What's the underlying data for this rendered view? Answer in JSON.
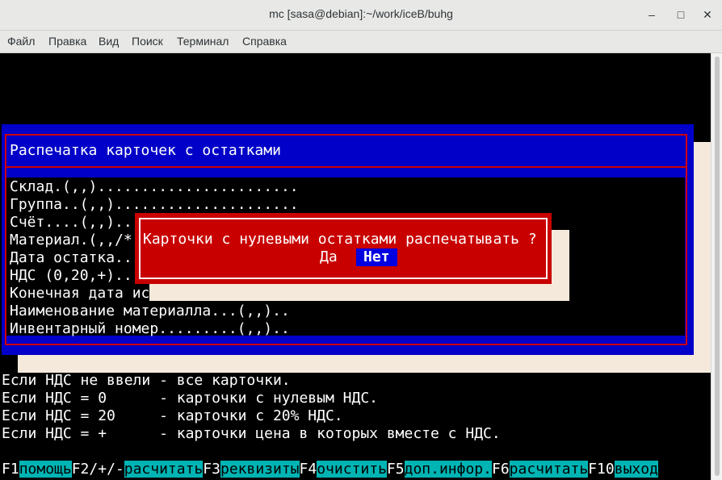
{
  "window": {
    "title": "mc [sasa@debian]:~/work/iceB/buhg",
    "minimize_glyph": "–",
    "maximize_glyph": "□",
    "close_glyph": "✕"
  },
  "menubar": {
    "items": [
      "Файл",
      "Правка",
      "Вид",
      "Поиск",
      "Терминал",
      "Справка"
    ]
  },
  "dialog": {
    "title": "Распечатка карточек с остатками",
    "fields": [
      "Склад.(,,).......................",
      "Группа..(,,).....................",
      "Счёт....(,,)..",
      "Материал.(,,/*",
      "Дата остатка..",
      "НДС (0,20,+)..",
      "Конечная дата ис",
      "Наименование материалла...(,,)..",
      "Инвентарный номер.........(,,).."
    ]
  },
  "confirm": {
    "question": "Карточки с нулевыми остатками распечатывать ?",
    "yes_label": "Да",
    "no_label": "Нет"
  },
  "help_lines": [
    "Если НДС не ввели - все карточки.",
    "Если НДС = 0      - карточки с нулевым НДС.",
    "Если НДС = 20     - карточки с 20% НДС.",
    "Если НДС = +      - карточки цена в которых вместе с НДС."
  ],
  "function_keys": [
    {
      "key": "F1",
      "label": "помощь"
    },
    {
      "key": "F2/+/-",
      "label": "расчитать"
    },
    {
      "key": "F3",
      "label": "реквизиты"
    },
    {
      "key": "F4",
      "label": "очистить"
    },
    {
      "key": "F5",
      "label": "доп.инфор."
    },
    {
      "key": "F6",
      "label": "расчитать"
    },
    {
      "key": "F10",
      "label": "выход"
    }
  ],
  "colors": {
    "dialog_bg": "#0000c8",
    "dialog_border": "#d00000",
    "confirm_bg": "#c80000",
    "selected_button_bg": "#0000e0",
    "fkey_label_bg": "#00b4b4",
    "shadow": "#f5e9dc"
  }
}
